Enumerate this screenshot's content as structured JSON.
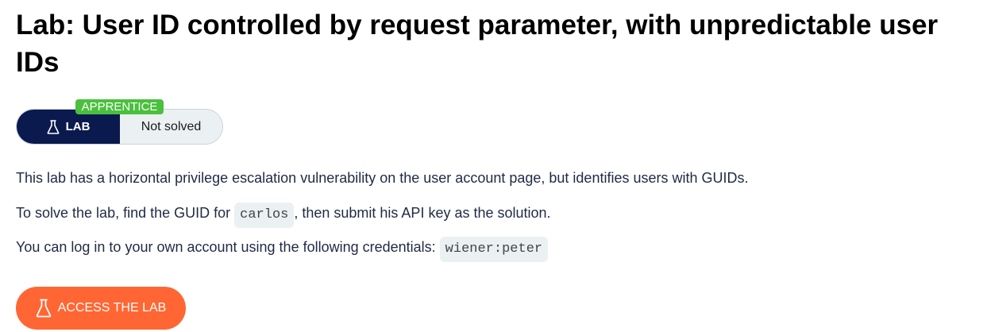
{
  "page": {
    "title": "Lab: User ID controlled by request parameter, with unpredictable user IDs"
  },
  "lab_status": {
    "level": "APPRENTICE",
    "tag_label": "LAB",
    "status": "Not solved"
  },
  "description": {
    "line1": "This lab has a horizontal privilege escalation vulnerability on the user account page, but identifies users with GUIDs.",
    "line2_before": "To solve the lab, find the GUID for ",
    "line2_code": "carlos",
    "line2_after": ", then submit his API key as the solution.",
    "line3_before": "You can log in to your own account using the following credentials: ",
    "line3_code": "wiener:peter"
  },
  "actions": {
    "access_label": "ACCESS THE LAB",
    "icon": "flask-icon"
  },
  "colors": {
    "lab_tag_bg": "#0a1a4f",
    "status_bg": "#ebf0f3",
    "level_badge": "#4ac03c",
    "access_button": "#ff6633"
  }
}
